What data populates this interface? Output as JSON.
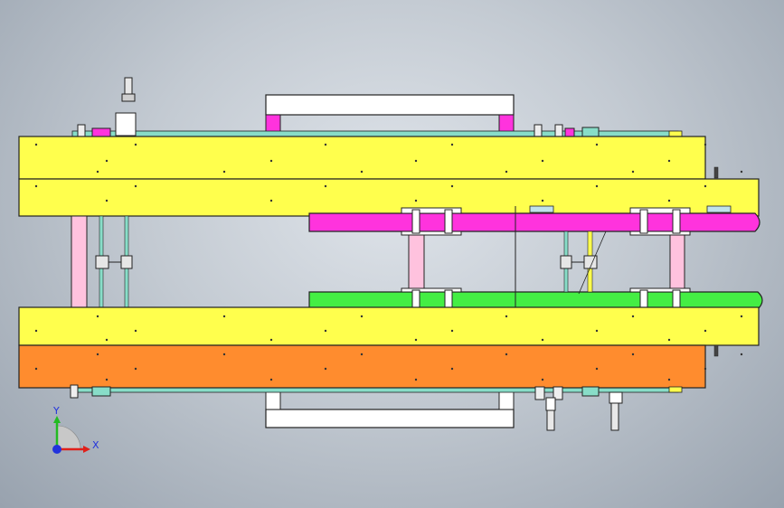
{
  "window": {
    "title": ""
  },
  "colors": {
    "yellow": "#ffff4d",
    "orange": "#ff8c2e",
    "magenta": "#ff33dd",
    "green": "#44ee44",
    "pink": "#ffc2de",
    "cyan": "#88ddc8",
    "white": "#ffffff",
    "axis_x": "#e0201a",
    "axis_y": "#22bb22",
    "axis_z": "#2233dd"
  },
  "triad": {
    "x_label": "X",
    "y_label": "Y",
    "icon": "coordinate-triad-icon"
  }
}
